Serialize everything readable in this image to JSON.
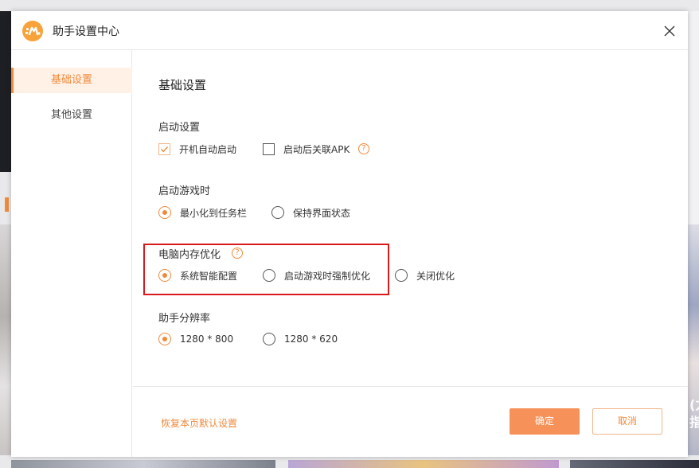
{
  "dialog": {
    "title": "助手设置中心",
    "logo_icon": "app-logo-icon",
    "close_icon": "close-icon"
  },
  "sidebar": {
    "items": [
      {
        "label": "基础设置",
        "active": true
      },
      {
        "label": "其他设置",
        "active": false
      }
    ]
  },
  "content": {
    "section_title": "基础设置",
    "startup": {
      "label": "启动设置",
      "options": [
        {
          "label": "开机自动启动",
          "checked": true
        },
        {
          "label": "启动后关联APK",
          "checked": false
        }
      ],
      "help_glyph": "?"
    },
    "game_launch": {
      "label": "启动游戏时",
      "options": [
        {
          "label": "最小化到任务栏",
          "selected": true
        },
        {
          "label": "保持界面状态",
          "selected": false
        }
      ]
    },
    "memory": {
      "label": "电脑内存优化",
      "help_glyph": "?",
      "options": [
        {
          "label": "系统智能配置",
          "selected": true
        },
        {
          "label": "启动游戏时强制优化",
          "selected": false
        },
        {
          "label": "关闭优化",
          "selected": false
        }
      ]
    },
    "resolution": {
      "label": "助手分辨率",
      "options": [
        {
          "label": "1280 * 800",
          "selected": true
        },
        {
          "label": "1280 * 620",
          "selected": false
        }
      ]
    }
  },
  "footer": {
    "reset_label": "恢复本页默认设置",
    "ok_label": "确定",
    "cancel_label": "取消"
  },
  "background": {
    "right_edge_text": "(力",
    "right_edge_text_2": "指"
  },
  "colors": {
    "accent": "#f08a3c",
    "primary_button": "#f6915a",
    "highlight_box": "#d9191c"
  }
}
